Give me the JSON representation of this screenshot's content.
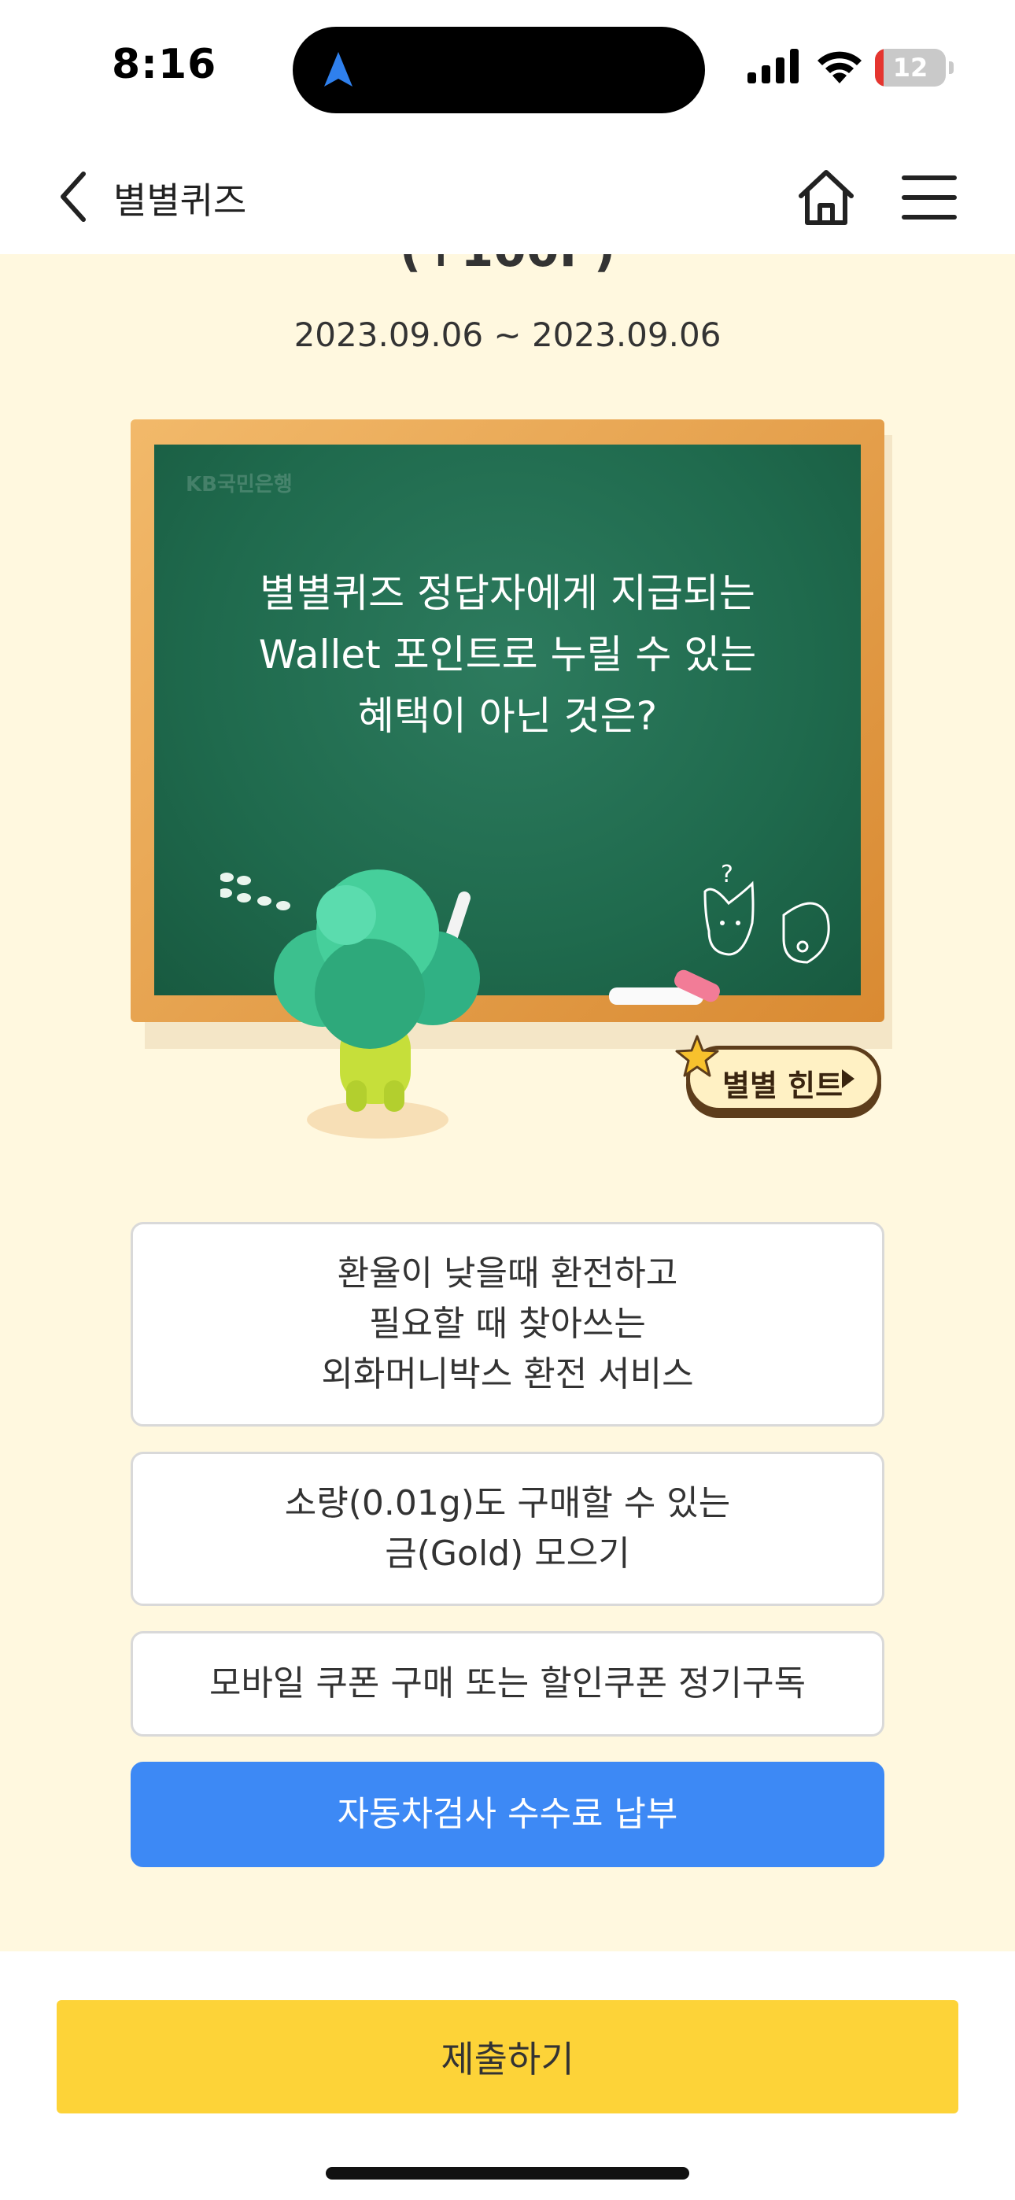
{
  "status_bar": {
    "time": "8:16",
    "battery": "12",
    "icons": [
      "location-arrow-icon",
      "signal-icon",
      "wifi-icon",
      "battery-icon"
    ]
  },
  "nav": {
    "title": "별별퀴즈",
    "icons": [
      "chevron-left-icon",
      "home-icon",
      "hamburger-menu-icon"
    ]
  },
  "quiz": {
    "title_cut": "(+100P)",
    "period": "2023.09.06 ~ 2023.09.06",
    "board_logo": "KB국민은행",
    "question": "별별퀴즈 정답자에게 지급되는\nWallet 포인트로 누릴 수 있는\n혜택이 아닌 것은?",
    "hint_label": "별별 힌트"
  },
  "answers": [
    {
      "text": "환율이 낮을때 환전하고\n필요할 때 찾아쓰는\n외화머니박스 환전 서비스",
      "selected": false
    },
    {
      "text": "소량(0.01g)도 구매할 수 있는\n금(Gold) 모으기",
      "selected": false
    },
    {
      "text": "모바일 쿠폰 구매 또는 할인쿠폰 정기구독",
      "selected": false
    },
    {
      "text": "자동차검사 수수료 납부",
      "selected": true
    }
  ],
  "submit_label": "제출하기",
  "colors": {
    "background": "#fff8df",
    "board": "#1f6a4d",
    "selected": "#3d89f5",
    "submit": "#fdd338",
    "battery_low": "#e5352f"
  }
}
